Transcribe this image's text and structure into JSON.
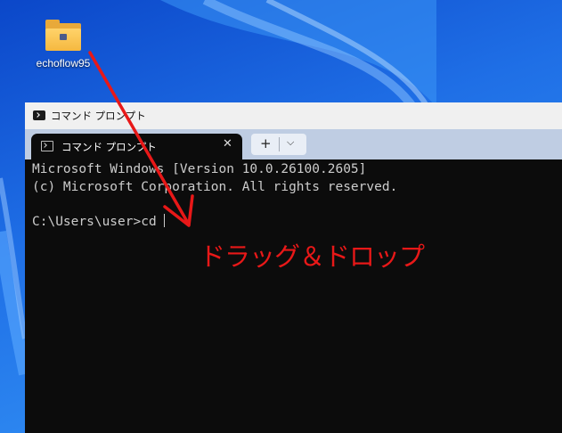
{
  "desktop": {
    "icon": {
      "label": "echoflow95",
      "icon": "folder-icon"
    }
  },
  "window": {
    "title": "コマンド プロンプト",
    "tab": {
      "label": "コマンド プロンプト",
      "close": "✕"
    },
    "new_tab": {
      "plus": "+",
      "dropdown": "⌵"
    },
    "console": {
      "lines": [
        "Microsoft Windows [Version 10.0.26100.2605]",
        "(c) Microsoft Corporation. All rights reserved.",
        "",
        "C:\\Users\\user>cd"
      ]
    }
  },
  "annotation": {
    "text": "ドラッグ＆ドロップ",
    "color": "#e81818"
  }
}
